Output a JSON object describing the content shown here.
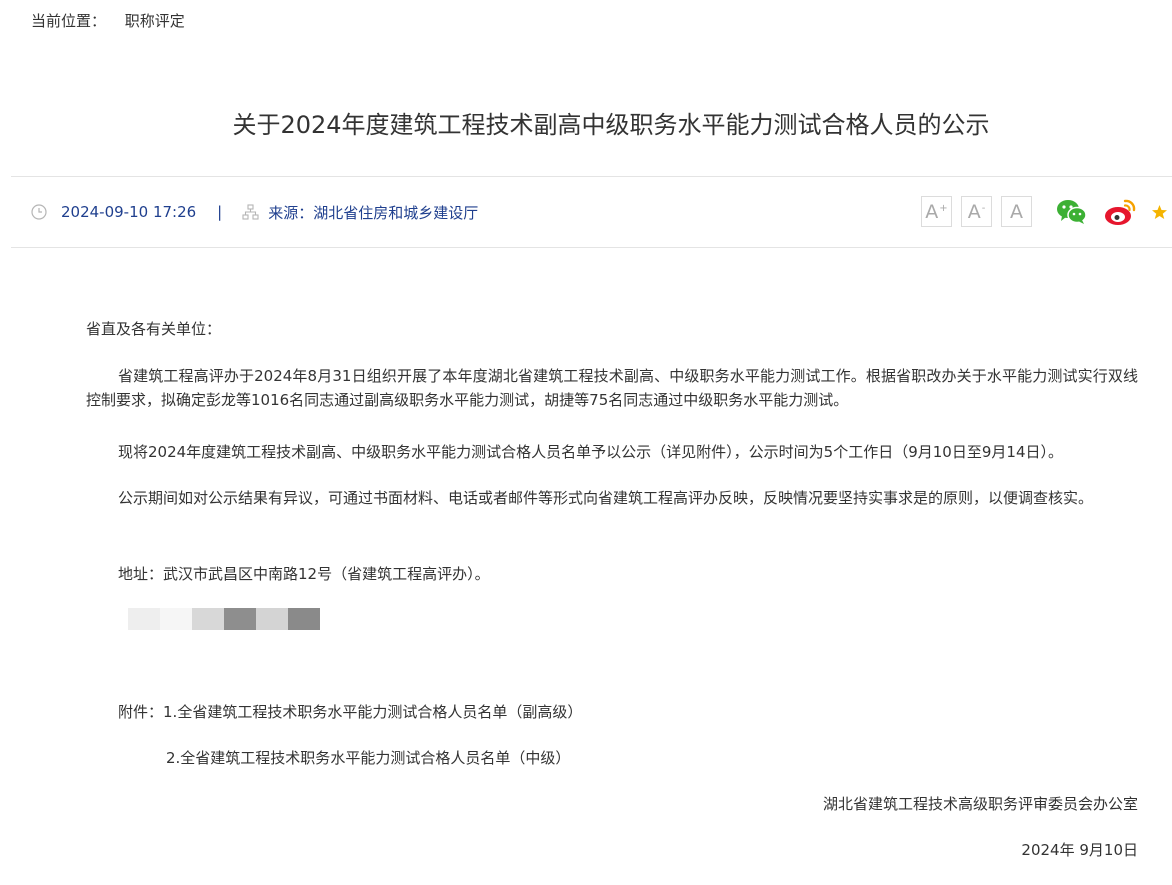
{
  "breadcrumb": {
    "label": "当前位置：",
    "current": "职称评定"
  },
  "article": {
    "title": "关于2024年度建筑工程技术副高中级职务水平能力测试合格人员的公示",
    "datetime": "2024-09-10 17:26",
    "separator": "|",
    "source": "来源：湖北省住房和城乡建设厅"
  },
  "font_controls": {
    "increase": "A",
    "decrease": "A",
    "reset": "A",
    "increase_sup": "+",
    "decrease_sup": "-"
  },
  "share_icons": [
    "wechat-icon",
    "weibo-icon",
    "favorite-icon"
  ],
  "body": {
    "salutation": "省直及各有关单位：",
    "para1": "省建筑工程高评办于2024年8月31日组织开展了本年度湖北省建筑工程技术副高、中级职务水平能力测试工作。根据省职改办关于水平能力测试实行双线控制要求，拟确定彭龙等1016名同志通过副高级职务水平能力测试，胡捷等75名同志通过中级职务水平能力测试。",
    "para2": "现将2024年度建筑工程技术副高、中级职务水平能力测试合格人员名单予以公示（详见附件），公示时间为5个工作日（9月10日至9月14日）。",
    "para3": "公示期间如对公示结果有异议，可通过书面材料、电话或者邮件等形式向省建筑工程高评办反映，反映情况要坚持实事求是的原则，以便调查核实。",
    "address": "地址：武汉市武昌区中南路12号（省建筑工程高评办）。",
    "attachment_label": "附件：",
    "attachment1": "1.全省建筑工程技术职务水平能力测试合格人员名单（副高级）",
    "attachment2": "2.全省建筑工程技术职务水平能力测试合格人员名单（中级）",
    "signature": "湖北省建筑工程技术高级职务评审委员会办公室",
    "date": "2024年 9月10日"
  },
  "colors": {
    "accent": "#1f3f8e",
    "text": "#333333",
    "divider": "#e4e4e4",
    "wechat": "#3cb034",
    "weibo": "#e6162d",
    "star": "#f5b400"
  }
}
